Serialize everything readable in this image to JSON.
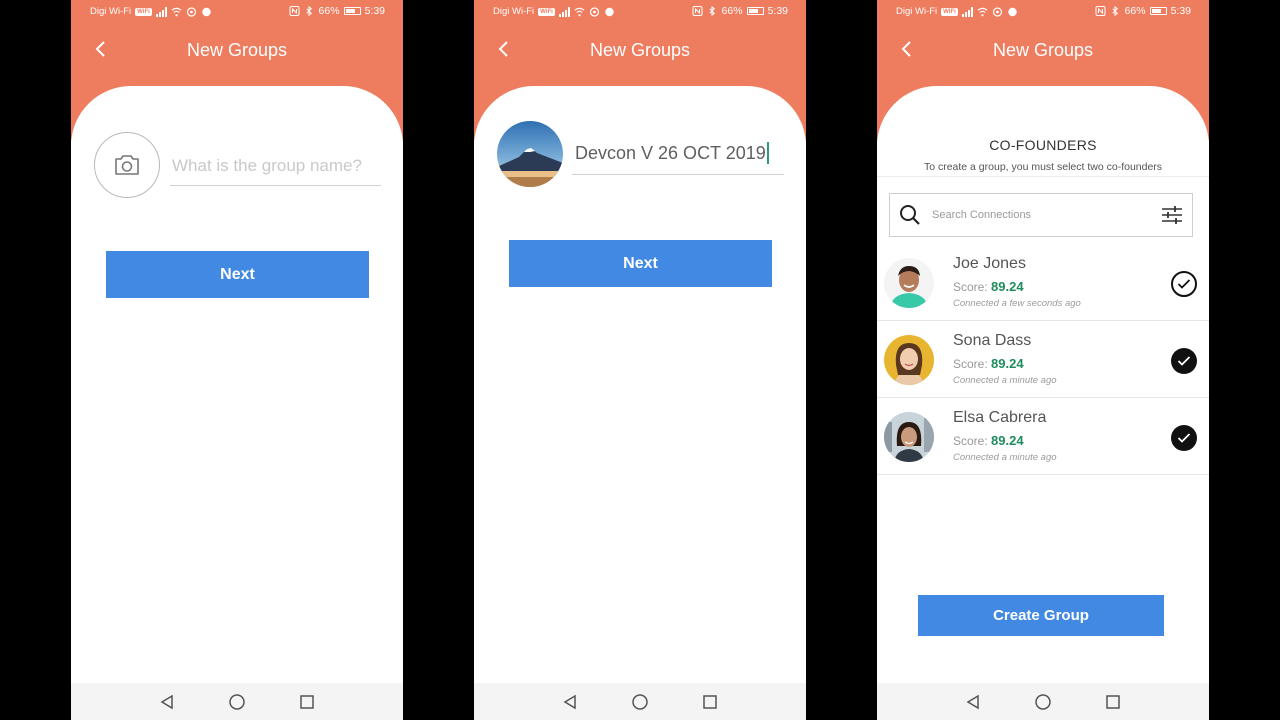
{
  "status": {
    "carrier": "Digi Wi-Fi",
    "wifi_tag": "WiFi",
    "battery": "66%",
    "time": "5:39"
  },
  "screens": [
    {
      "title": "New Groups",
      "group_name_placeholder": "What is the group name?",
      "next_label": "Next"
    },
    {
      "title": "New Groups",
      "group_name_value": "Devcon V 26 OCT 2019",
      "next_label": "Next"
    },
    {
      "title": "New Groups",
      "section_title": "CO-FOUNDERS",
      "section_subtitle": "To create a group, you must select two co-founders",
      "search_placeholder": "Search Connections",
      "score_label": "Score:",
      "contacts": [
        {
          "name": "Joe Jones",
          "score": "89.24",
          "connected": "Connected a few seconds ago",
          "selected": "outline"
        },
        {
          "name": "Sona Dass",
          "score": "89.24",
          "connected": "Connected a minute ago",
          "selected": "filled"
        },
        {
          "name": "Elsa Cabrera",
          "score": "89.24",
          "connected": "Connected a minute ago",
          "selected": "filled"
        }
      ],
      "create_label": "Create Group"
    }
  ],
  "colors": {
    "header": "#EE7C5F",
    "button": "#4189E3",
    "score": "#1E8C5C"
  },
  "icons": {
    "back": "chevron-left-icon",
    "camera": "camera-icon",
    "search": "search-icon",
    "filter": "sliders-icon",
    "check": "check-circle-icon",
    "nav": [
      "back-triangle-icon",
      "home-circle-icon",
      "recents-square-icon"
    ]
  }
}
